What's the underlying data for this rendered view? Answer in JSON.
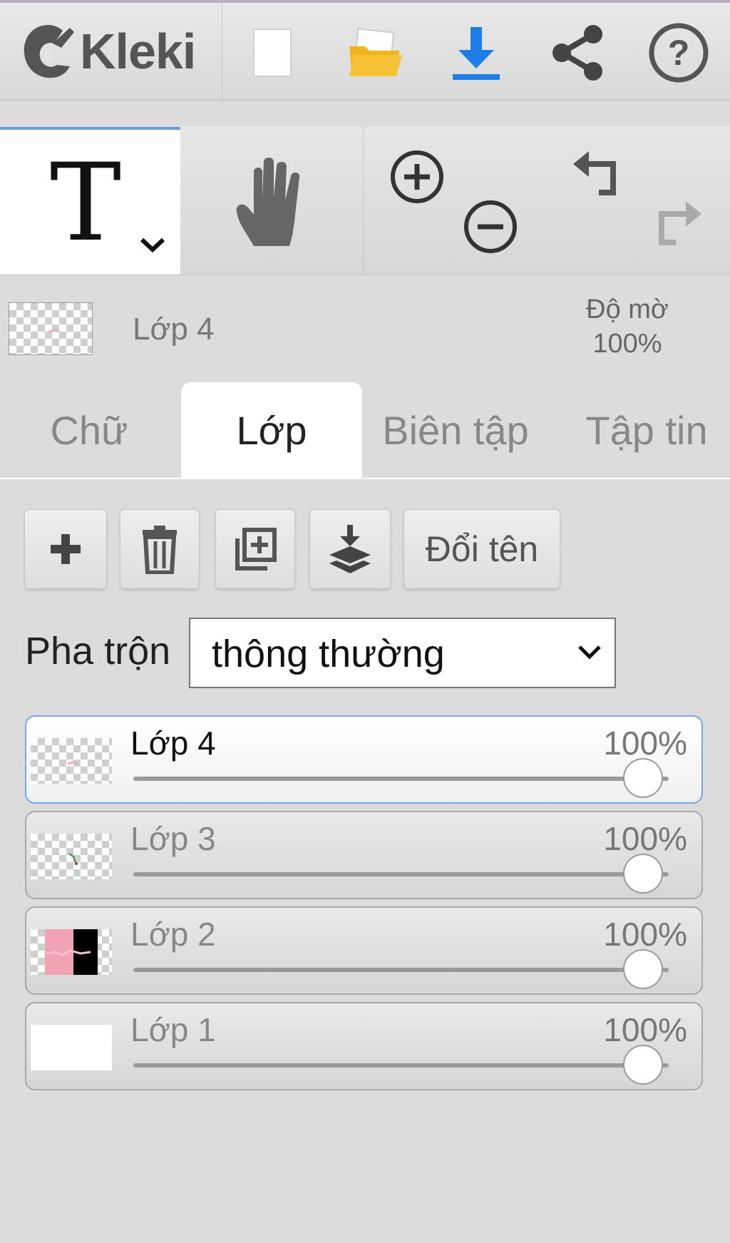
{
  "app": {
    "logo_text": "Kleki"
  },
  "toolbar": {
    "buttons": [
      {
        "name": "new-image",
        "icon": "blank-page-icon"
      },
      {
        "name": "open-file",
        "icon": "folder-icon"
      },
      {
        "name": "save",
        "icon": "download-icon",
        "color": "#1e7ee6"
      },
      {
        "name": "share",
        "icon": "share-icon"
      },
      {
        "name": "help",
        "icon": "help-icon"
      }
    ]
  },
  "tools": {
    "active_tool": "text",
    "text_tool_glyph": "T",
    "accent": "#6a9de0"
  },
  "layer_info": {
    "current_layer": "Lớp 4",
    "opacity_label": "Độ mờ",
    "opacity_value": "100%"
  },
  "tabs": [
    {
      "label": "Chữ",
      "active": false
    },
    {
      "label": "Lớp",
      "active": true
    },
    {
      "label": "Biên tập",
      "active": false
    },
    {
      "label": "Tập tin",
      "active": false
    }
  ],
  "layer_actions": {
    "add": "add-icon",
    "delete": "trash-icon",
    "duplicate": "duplicate-icon",
    "merge_down": "merge-down-icon",
    "rename_label": "Đổi tên"
  },
  "blend": {
    "label": "Pha trộn",
    "value": "thông thường"
  },
  "layers": [
    {
      "name": "Lớp 4",
      "opacity": "100%",
      "opacity_value": 1.0,
      "selected": true
    },
    {
      "name": "Lớp 3",
      "opacity": "100%",
      "opacity_value": 1.0,
      "selected": false
    },
    {
      "name": "Lớp 2",
      "opacity": "100%",
      "opacity_value": 1.0,
      "selected": false
    },
    {
      "name": "Lớp 1",
      "opacity": "100%",
      "opacity_value": 1.0,
      "selected": false
    }
  ]
}
